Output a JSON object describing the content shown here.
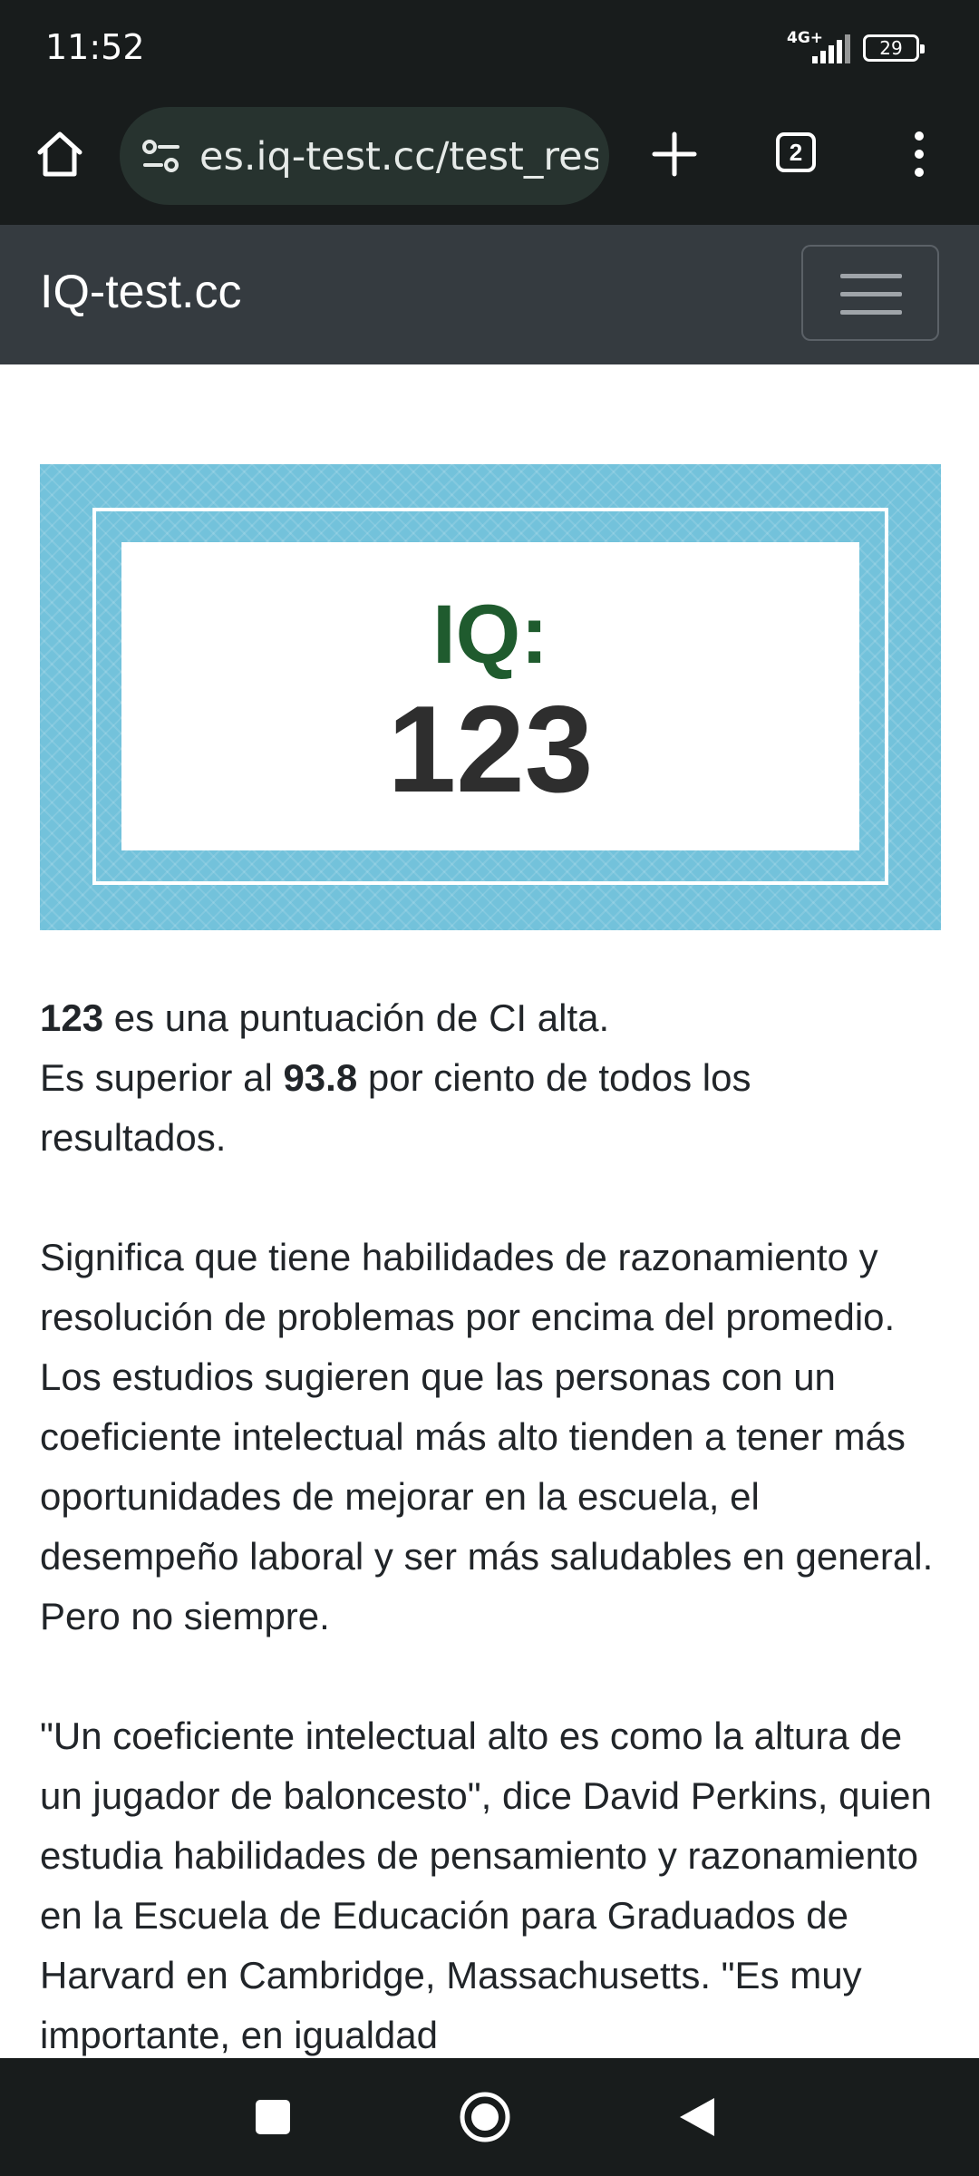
{
  "status_bar": {
    "time": "11:52",
    "network_type": "4G+",
    "battery_level": "29"
  },
  "browser": {
    "url": "es.iq-test.cc/test_resu",
    "tab_count": "2",
    "icons": [
      "home-icon",
      "site-settings-icon",
      "new-tab-icon",
      "tab-switcher-icon",
      "more-vert-icon"
    ]
  },
  "site": {
    "brand": "IQ-test.cc",
    "menu_icon": "hamburger-icon"
  },
  "result": {
    "label": "IQ:",
    "score": "123"
  },
  "article": {
    "p1_score": "123",
    "p1_text_a": " es una puntuación de CI alta.",
    "p1_text_b": "Es superior al ",
    "p1_percent": "93.8",
    "p1_text_c": " por ciento de todos los resultados.",
    "p2": "Significa que tiene habilidades de razonamiento y resolución de problemas por encima del promedio. Los estudios sugieren que las personas con un coeficiente intelectual más alto tienden a tener más oportunidades de mejorar en la escuela, el desempeño laboral y ser más saludables en general. Pero no siempre.",
    "p3": "\"Un coeficiente intelectual alto es como la altura de un jugador de baloncesto\", dice David Perkins, quien estudia habilidades de pensamiento y razonamiento en la Escuela de Educación para Graduados de Harvard en Cambridge, Massachusetts. \"Es muy importante, en igualdad"
  },
  "colors": {
    "system_bar": "#181c1c",
    "urlbar": "#27332f",
    "navbar": "#353b40",
    "banner": "#73c2db",
    "iq_label": "#1f5b2e",
    "iq_score": "#2e2e2e"
  },
  "system_nav": {
    "icons": [
      "recents-square-icon",
      "home-circle-icon",
      "back-triangle-icon"
    ]
  }
}
